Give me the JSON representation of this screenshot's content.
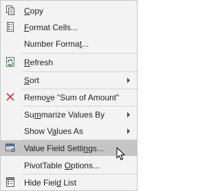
{
  "menu": {
    "copy": {
      "pre": "",
      "key": "C",
      "post": "opy"
    },
    "format_cells": {
      "pre": "",
      "key": "F",
      "post": "ormat Cells..."
    },
    "number_format": {
      "pre": "Number Forma",
      "key": "t",
      "post": "..."
    },
    "refresh": {
      "pre": "",
      "key": "R",
      "post": "efresh"
    },
    "sort": {
      "pre": "",
      "key": "S",
      "post": "ort"
    },
    "remove": {
      "pre": "Remo",
      "key": "v",
      "post": "e “Sum of Amount”"
    },
    "summarize": {
      "pre": "Su",
      "key": "m",
      "post": "marize Values By"
    },
    "show_values": {
      "pre": "Show V",
      "key": "a",
      "post": "lues As"
    },
    "value_field_settings": {
      "pre": "Value Field Setti",
      "key": "n",
      "post": "gs..."
    },
    "pivottable_options": {
      "pre": "PivotTable ",
      "key": "O",
      "post": "ptions..."
    },
    "hide_field_list": {
      "pre": "Hide Fiel",
      "key": "d",
      "post": " List"
    }
  },
  "icons": {
    "copy": "copy-icon",
    "format_cells": "format-cells-icon",
    "refresh": "refresh-icon",
    "remove": "remove-x-icon",
    "value_field_settings": "field-settings-icon",
    "hide_field_list": "field-list-icon",
    "submenu": "chevron-right-icon",
    "cursor": "mouse-pointer-icon"
  },
  "colors": {
    "menu_background": "#f3f3f3",
    "highlight": "#c5c5c5",
    "remove_x": "#d13438",
    "refresh_green": "#3a8a3a"
  }
}
